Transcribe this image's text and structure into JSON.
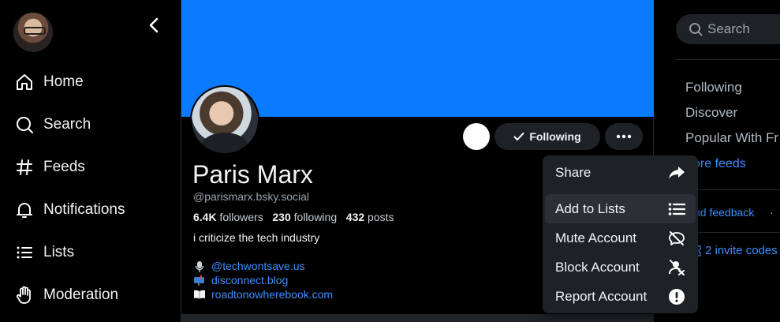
{
  "nav": {
    "items": [
      {
        "label": "Home",
        "icon": "home-icon"
      },
      {
        "label": "Search",
        "icon": "search-icon"
      },
      {
        "label": "Feeds",
        "icon": "hash-icon"
      },
      {
        "label": "Notifications",
        "icon": "bell-icon"
      },
      {
        "label": "Lists",
        "icon": "list-icon"
      },
      {
        "label": "Moderation",
        "icon": "hand-icon"
      }
    ]
  },
  "profile": {
    "name": "Paris Marx",
    "handle": "@parismarx.bsky.social",
    "followers_count": "6.4K",
    "followers_label": "followers",
    "following_count": "230",
    "following_label": "following",
    "posts_count": "432",
    "posts_label": "posts",
    "bio": "i criticize the tech industry",
    "links": [
      {
        "text": "@techwontsave.us",
        "icon": "microphone-icon"
      },
      {
        "text": "disconnect.blog",
        "icon": "mailbox-icon"
      },
      {
        "text": "roadtonowherebook.com",
        "icon": "book-icon"
      }
    ],
    "following_button": "Following"
  },
  "menu": {
    "items": [
      {
        "label": "Share",
        "icon": "share-arrow-icon"
      },
      {
        "label": "Add to Lists",
        "icon": "list-icon"
      },
      {
        "label": "Mute Account",
        "icon": "speech-bubble-muted-icon"
      },
      {
        "label": "Block Account",
        "icon": "person-blocked-icon"
      },
      {
        "label": "Report Account",
        "icon": "exclamation-circle-icon"
      }
    ]
  },
  "right": {
    "search_placeholder": "Search",
    "feeds": [
      "Following",
      "Discover",
      "Popular With Fr"
    ],
    "more_feeds": "ore feeds",
    "feedback": "nd feedback",
    "sep": "·",
    "invite_codes": "2 invite codes"
  },
  "colors": {
    "banner": "#0a7aff",
    "link": "#3d8fff",
    "menu_bg": "#1e2227"
  }
}
